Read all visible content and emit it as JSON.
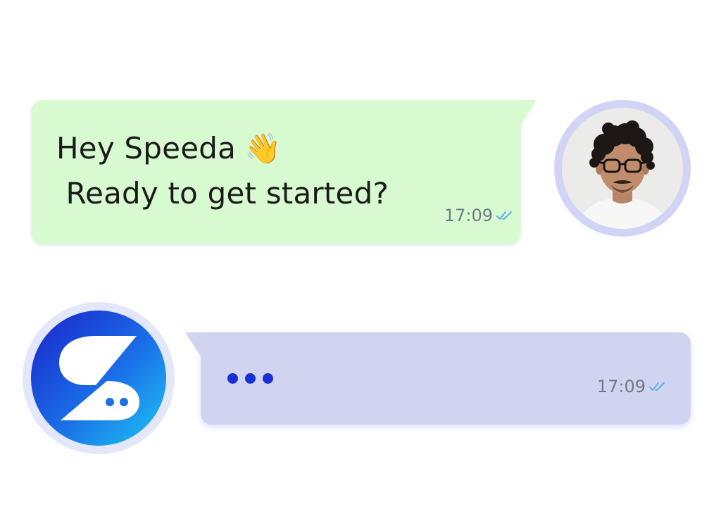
{
  "chat": {
    "outgoing": {
      "line1": "Hey Speeda",
      "emoji": "👋",
      "line2": " Ready to get started?",
      "time": "17:09",
      "status_icon": "double-check-icon",
      "bubble_color": "#d8fad0"
    },
    "incoming": {
      "typing_indicator": "•••",
      "time": "17:09",
      "status_icon": "double-check-icon",
      "bubble_color": "#d1d4f0",
      "dot_color": "#1a2fd6"
    },
    "avatars": {
      "user": {
        "icon": "user-photo-avatar",
        "ring_color": "#d1d4f4"
      },
      "bot": {
        "icon": "speeda-logo-icon",
        "gradient": [
          "#1a2fd6",
          "#1ec8f5"
        ]
      }
    },
    "tick_color": "#4fa8e8"
  }
}
